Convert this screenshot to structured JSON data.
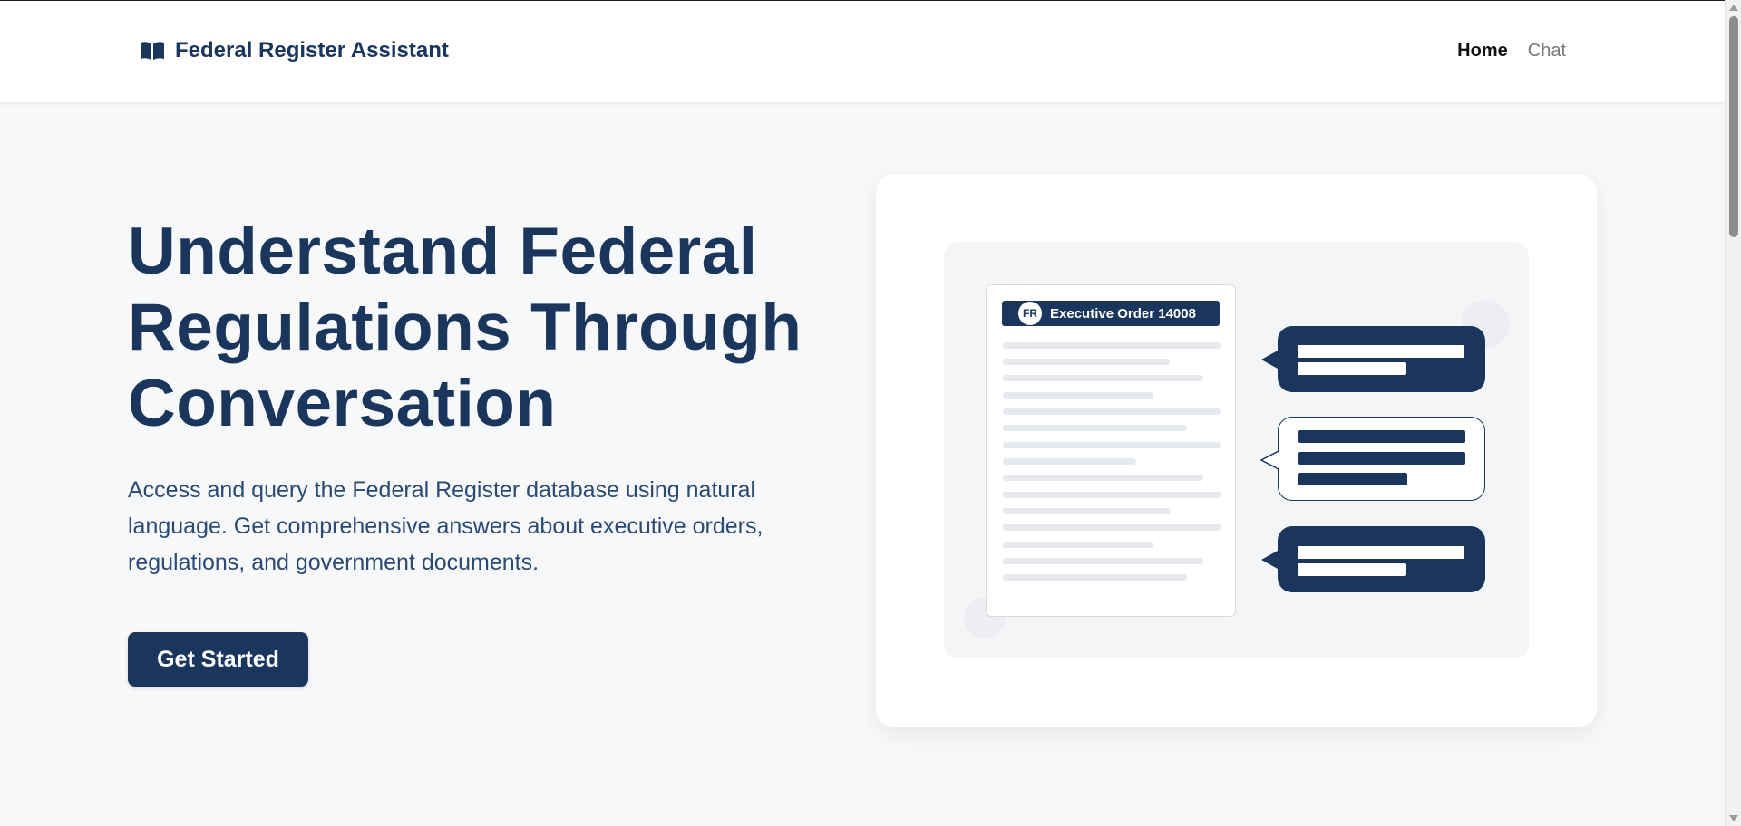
{
  "header": {
    "brand": "Federal Register Assistant",
    "brand_icon": "open-book-icon",
    "nav": [
      {
        "label": "Home",
        "active": true
      },
      {
        "label": "Chat",
        "active": false
      }
    ]
  },
  "hero": {
    "title_lines": [
      "Understand Federal",
      "Regulations Through",
      "Conversation"
    ],
    "description": "Access and query the Federal Register database using natural language. Get comprehensive answers about executive orders, regulations, and government documents.",
    "cta_label": "Get Started"
  },
  "illustration": {
    "badge": "FR",
    "document_title": "Executive Order 14008"
  },
  "colors": {
    "primary": "#1b365d",
    "background": "#f7f8fa",
    "muted_text": "#777777"
  }
}
